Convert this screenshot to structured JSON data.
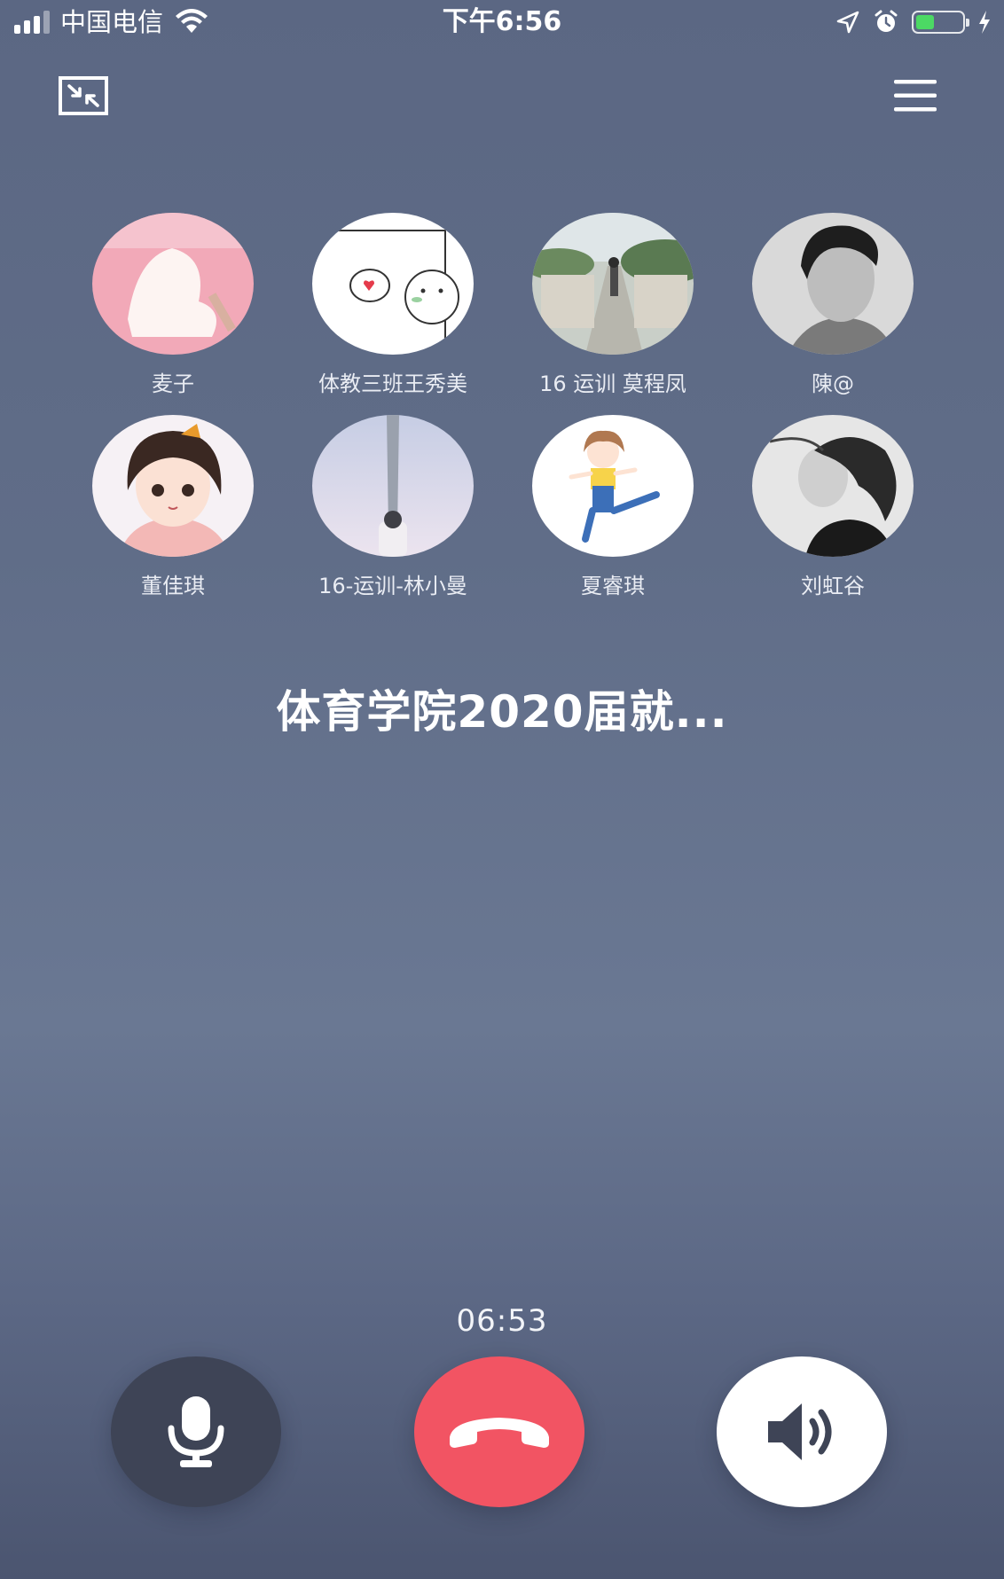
{
  "status_bar": {
    "carrier": "中国电信",
    "time": "下午6:56",
    "battery_level": 0.4,
    "battery_color": "#4cd964"
  },
  "controls": {
    "minimize_icon": "minimize-icon",
    "menu_icon": "menu-icon"
  },
  "participants": [
    {
      "name": "麦子",
      "avatar": "pink-silhouette-avatar"
    },
    {
      "name": "体教三班王秀美",
      "avatar": "cartoon-heart-avatar"
    },
    {
      "name": "16   运训   莫程凤",
      "avatar": "bridge-walk-avatar"
    },
    {
      "name": "陳@",
      "avatar": "grayscale-man-avatar"
    },
    {
      "name": "董佳琪",
      "avatar": "anime-girl-avatar"
    },
    {
      "name": "16-运训-林小曼",
      "avatar": "sky-tower-avatar"
    },
    {
      "name": "夏睿琪",
      "avatar": "cartoon-dancer-avatar"
    },
    {
      "name": "刘虹谷",
      "avatar": "grayscale-woman-avatar"
    }
  ],
  "call": {
    "group_title": "体育学院2020届就...",
    "duration": "06:53"
  },
  "buttons": {
    "mic_icon": "microphone-icon",
    "hangup_icon": "hang-up-phone-icon",
    "speaker_icon": "speaker-icon"
  },
  "colors": {
    "hangup": "#f25463",
    "mic_bg": "#3e4456",
    "speaker_bg": "#ffffff"
  }
}
